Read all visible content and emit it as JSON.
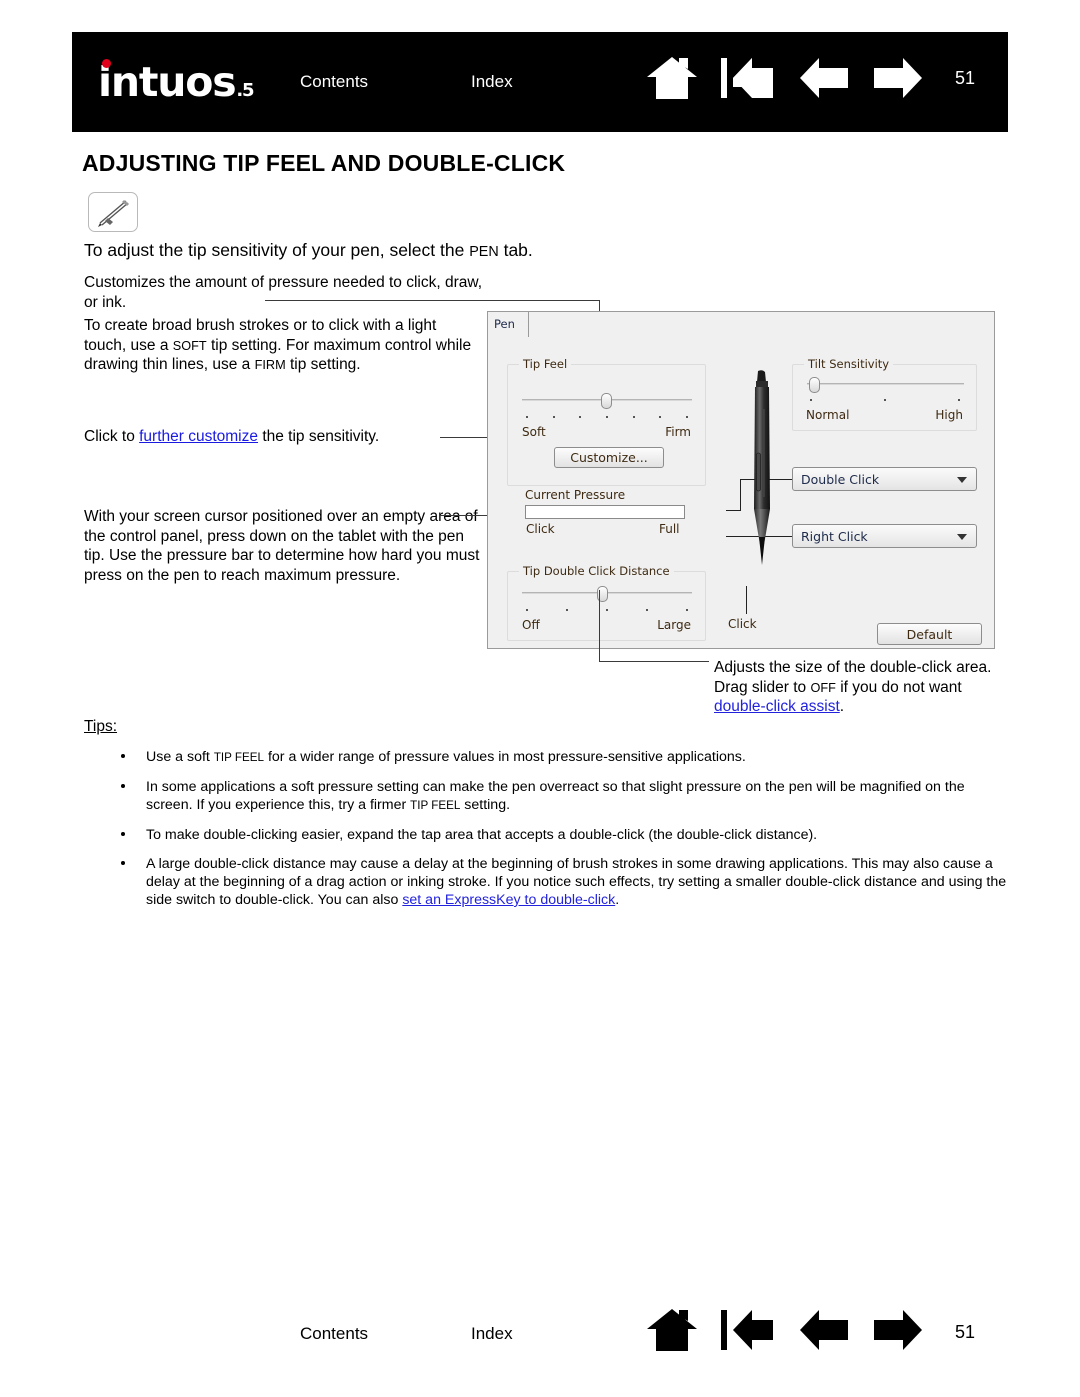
{
  "header": {
    "logo": "intuos",
    "logo_sub": ".5",
    "contents_label": "Contents",
    "index_label": "Index",
    "page_number": "51",
    "icons": [
      "home-icon",
      "go-to-start-icon",
      "previous-page-icon",
      "next-page-icon"
    ]
  },
  "title": "ADJUSTING TIP FEEL AND DOUBLE-CLICK",
  "badge_icon": "pen-tool-icon",
  "intro": {
    "before": "To adjust the tip sensitivity of your pen, select the ",
    "smallcaps": "PEN",
    "after": " tab."
  },
  "callouts": {
    "p1": "Customizes the amount of pressure needed to click, draw, or ink.",
    "p2_a": "To create broad brush strokes or to click with a light touch, use a ",
    "p2_sc1": "SOFT",
    "p2_b": " tip setting.  For maximum control while drawing thin lines, use a ",
    "p2_sc2": "FIRM",
    "p2_c": " tip setting.",
    "p3_a": "Click to ",
    "p3_link": "further customize",
    "p3_b": " the tip sensitivity.",
    "p4": "With your screen cursor positioned over an empty area of the control panel, press down on the tablet with the pen tip.  Use the pressure bar to determine how hard you must press on the pen to reach maximum pressure.",
    "right_a": "Adjusts the size of the double-click area.  Drag slider to ",
    "right_sc": "OFF",
    "right_b": " if you do not want ",
    "right_link": "double-click assist",
    "right_c": "."
  },
  "control_panel": {
    "tab_label": "Pen",
    "tip_feel": {
      "group_title": "Tip Feel",
      "min_label": "Soft",
      "max_label": "Firm",
      "tick_count": 7,
      "thumb_position_percent": 50
    },
    "customize_button": "Customize...",
    "current_pressure": {
      "label": "Current Pressure",
      "min_label": "Click",
      "max_label": "Full",
      "fill_percent": 0
    },
    "tip_double_click_distance": {
      "group_title": "Tip Double Click Distance",
      "min_label": "Off",
      "max_label": "Large",
      "tick_count": 5,
      "thumb_position_percent": 47
    },
    "tilt_sensitivity": {
      "group_title": "Tilt Sensitivity",
      "min_label": "Normal",
      "max_label": "High",
      "tick_count": 3,
      "thumb_position_percent": 2
    },
    "pen_tip_label": "Click",
    "dropdown_double_click": "Double Click",
    "dropdown_right_click": "Right Click",
    "default_button": "Default",
    "pen_illustration_icon": "stylus-pen-illustration"
  },
  "tips": {
    "label": "Tips:",
    "items": [
      {
        "parts": [
          {
            "t": "Use a soft "
          },
          {
            "t": "TIP FEEL",
            "sc": true
          },
          {
            "t": " for a wider range of pressure values in most pressure-sensitive applications."
          }
        ]
      },
      {
        "parts": [
          {
            "t": "In some applications a soft pressure setting can make the pen overreact so that slight pressure on the pen will be magnified on the screen.  If you experience this, try a firmer "
          },
          {
            "t": "TIP FEEL",
            "sc": true
          },
          {
            "t": " setting."
          }
        ]
      },
      {
        "parts": [
          {
            "t": "To make double-clicking easier, expand the tap area that accepts a double-click (the double-click distance)."
          }
        ]
      },
      {
        "parts": [
          {
            "t": "A large double-click distance may cause a delay at the beginning of brush strokes in some drawing applications.  This may also cause a delay at the beginning of a drag action or inking stroke.  If you notice such effects, try setting a smaller double-click distance and using the side switch to double-click.  You can also "
          },
          {
            "t": "set an ExpressKey to double-click",
            "link": true
          },
          {
            "t": "."
          }
        ]
      }
    ]
  },
  "footer": {
    "contents_label": "Contents",
    "index_label": "Index",
    "page_number": "51",
    "icons": [
      "home-icon",
      "go-to-start-icon",
      "previous-page-icon",
      "next-page-icon"
    ]
  },
  "colors": {
    "brand_red": "#e0001b",
    "link_blue": "#1a1ae0",
    "header_bg": "#000000",
    "panel_bg": "#f0f0f0"
  }
}
